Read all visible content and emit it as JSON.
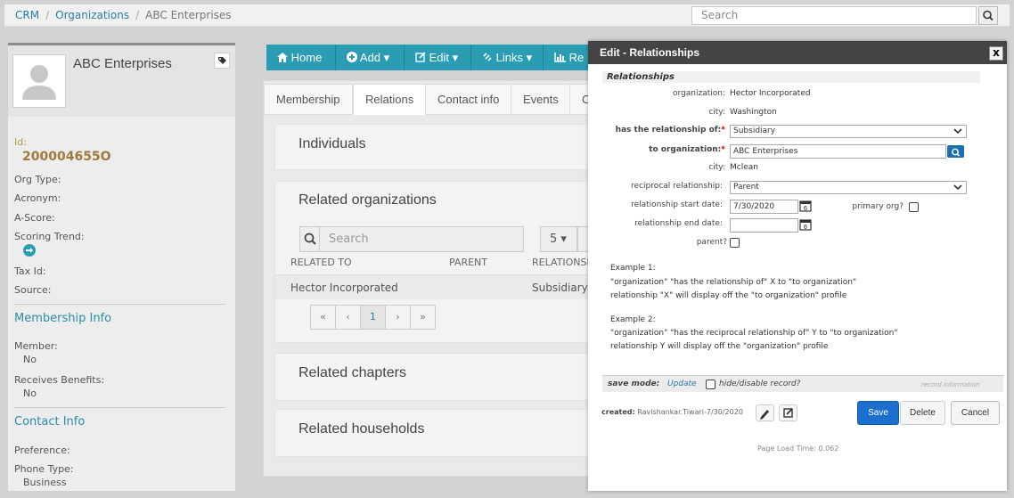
{
  "breadcrumb": {
    "items": [
      "CRM",
      "Organizations"
    ],
    "current": "ABC Enterprises"
  },
  "topsearch": {
    "placeholder": "Search"
  },
  "profile": {
    "name": "ABC Enterprises",
    "id_label": "Id:",
    "id_value": "200004655O",
    "org_type_label": "Org Type:",
    "acronym_label": "Acronym:",
    "ascore_label": "A-Score:",
    "scoring_trend_label": "Scoring Trend:",
    "taxid_label": "Tax Id:",
    "source_label": "Source:",
    "membership_title": "Membership Info",
    "member_label": "Member:",
    "member_value": "No",
    "benefits_label": "Receives Benefits:",
    "benefits_value": "No",
    "contact_title": "Contact Info",
    "preference_label": "Preference:",
    "phonetype_label": "Phone Type:",
    "phonetype_value": "Business"
  },
  "toolbar": {
    "home": "Home",
    "add": "Add",
    "edit": "Edit",
    "links": "Links",
    "reports": "Re"
  },
  "tabs": [
    "Membership",
    "Relations",
    "Contact info",
    "Events",
    "C"
  ],
  "main": {
    "individuals_title": "Individuals",
    "related_orgs_title": "Related organizations",
    "search_placeholder": "Search",
    "page_size": "5",
    "col_related_to": "RELATED TO",
    "col_parent": "PARENT",
    "col_relationship": "RELATIONSH",
    "row_related_to": "Hector Incorporated",
    "row_relationship": "Subsidiary",
    "pager": [
      "«",
      "‹",
      "1",
      "›",
      "»"
    ],
    "chapters_title": "Related chapters",
    "households_title": "Related households"
  },
  "modal": {
    "title": "Edit - Relationships",
    "close": "x",
    "section": "Relationships",
    "org_label": "organization:",
    "org_value": "Hector Incorporated",
    "city_label": "city:",
    "city_value": "Washington",
    "has_rel_label": "has the relationship of:",
    "has_rel_value": "Subsidiary",
    "to_org_label": "to organization:",
    "to_org_value": "ABC Enterprises",
    "city2_label": "city:",
    "city2_value": "Mclean",
    "reciprocal_label": "reciprocal relationship:",
    "reciprocal_value": "Parent",
    "start_label": "relationship start date:",
    "start_value": "7/30/2020",
    "primary_label": "primary org?",
    "end_label": "relationship end date:",
    "end_value": "",
    "parent_label": "parent?",
    "ex1_title": "Example 1:",
    "ex1_line1": "\"organization\" \"has the relationship of\" X to \"to organization\"",
    "ex1_line2": "relationship \"X\" will display off the \"to organization\" profile",
    "ex2_title": "Example 2:",
    "ex2_line1": "\"organization\" \"has the reciprocal relationship of\" Y to \"to organization\"",
    "ex2_line2": "relationship Y will display off the \"organization\" profile",
    "save_mode_label": "save mode:",
    "save_mode_value": "Update",
    "hide_label": "hide/disable record?",
    "record_info": "record information",
    "created_label": "created:",
    "created_value": "Ravishankar.Tiwari-7/30/2020",
    "save": "Save",
    "delete": "Delete",
    "cancel": "Cancel",
    "page_load": "Page Load Time: 0.062"
  },
  "colors": {
    "accent": "#2a9db4",
    "link": "#2a7da4",
    "primary_button": "#1a6fcf",
    "modal_header": "#444444",
    "id_value": "#a07a3a"
  }
}
